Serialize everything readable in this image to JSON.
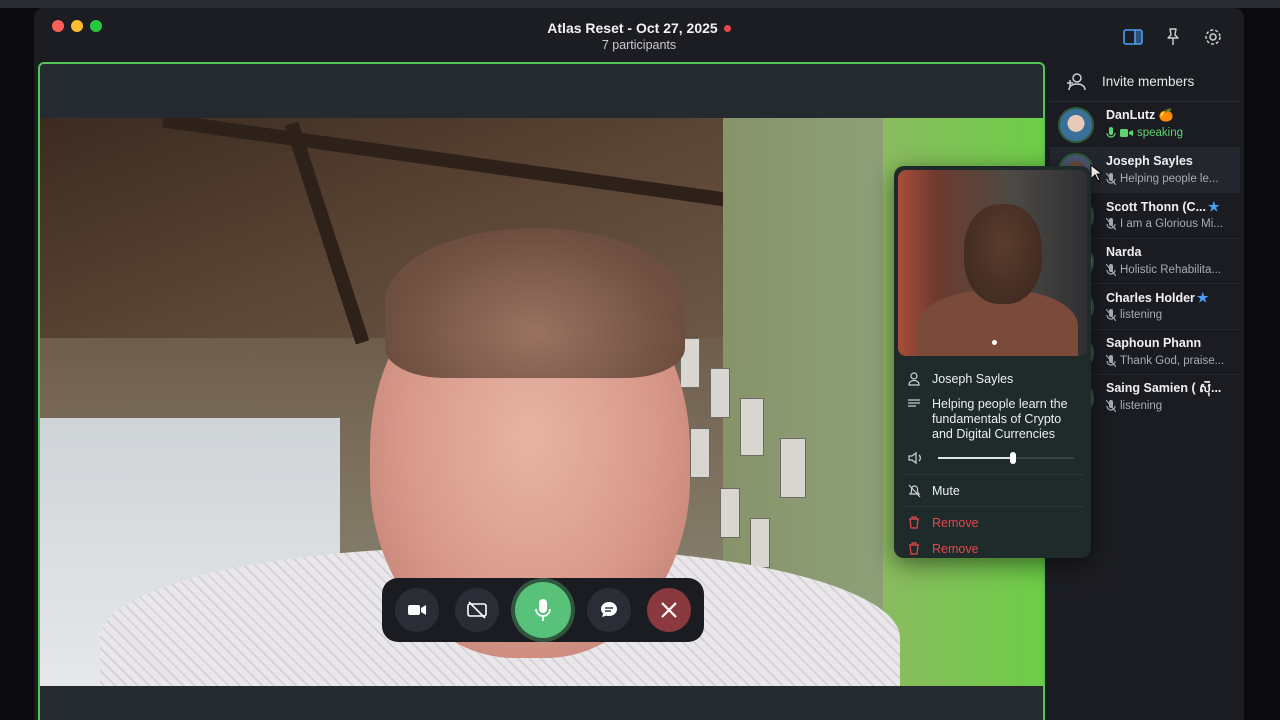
{
  "window": {
    "title": "Atlas Reset - Oct 27, 2025",
    "subtitle": "7 participants"
  },
  "sidebar": {
    "invite_label": "Invite members",
    "participants": [
      {
        "name": "DanLutz",
        "status": "speaking",
        "badge": "🍊"
      },
      {
        "name": "Joseph Sayles",
        "status": "Helping people le..."
      },
      {
        "name": "Scott Thonn (C...",
        "status": "I am a Glorious Mi...",
        "badge": "★"
      },
      {
        "name": "Narda",
        "status": "Holistic Rehabilita..."
      },
      {
        "name": "Charles Holder",
        "status": "listening",
        "badge": "★"
      },
      {
        "name": "Saphoun Phann",
        "status": "Thank God, praise..."
      },
      {
        "name": "Saing Samien ( ស៊ី...",
        "status": "listening"
      }
    ]
  },
  "popup": {
    "name": "Joseph Sayles",
    "bio": "Helping people learn the fundamentals of Crypto and Digital Currencies",
    "volume": 0.55,
    "mute_label": "Mute",
    "remove_label_1": "Remove",
    "remove_label_2": "Remove"
  },
  "controls": {
    "buttons": [
      "camera",
      "screen-share-off",
      "microphone",
      "chat",
      "end-call"
    ]
  },
  "colors": {
    "speaking_green": "#5fd36e",
    "stage_border": "#57c35a",
    "danger": "#e5484d",
    "accent_blue": "#4a9ef5"
  }
}
